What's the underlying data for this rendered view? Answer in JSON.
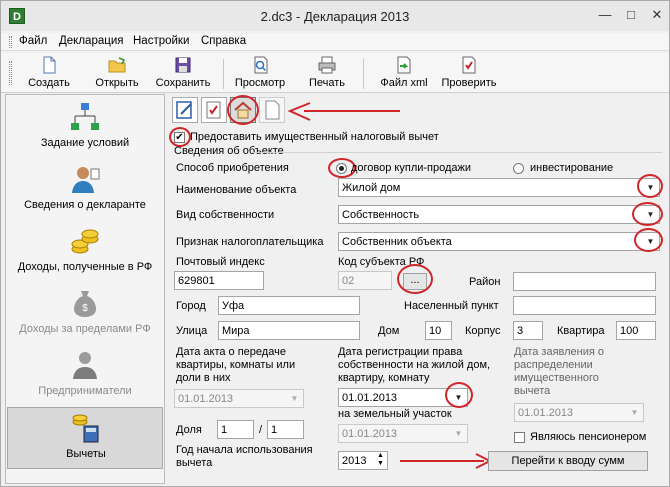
{
  "window": {
    "title": "2.dc3 - Декларация 2013",
    "app_icon": "D"
  },
  "menu": [
    "Файл",
    "Декларация",
    "Настройки",
    "Справка"
  ],
  "toolbar": {
    "create": "Создать",
    "open": "Открыть",
    "save": "Сохранить",
    "preview": "Просмотр",
    "print": "Печать",
    "xml": "Файл xml",
    "check": "Проверить"
  },
  "sidebar": [
    {
      "label": "Задание условий"
    },
    {
      "label": "Сведения о декларанте"
    },
    {
      "label": "Доходы, полученные в РФ"
    },
    {
      "label": "Доходы за пределами РФ"
    },
    {
      "label": "Предприниматели"
    },
    {
      "label": "Вычеты"
    }
  ],
  "form": {
    "provide_deduction": "Предоставить имущественный налоговый вычет",
    "section_title": "Сведения об объекте",
    "acquisition_method": "Способ приобретения",
    "opt_contract": "договор купли-продажи",
    "opt_investment": "инвестирование",
    "object_name_label": "Наименование объекта",
    "object_name_value": "Жилой дом",
    "ownership_label": "Вид собственности",
    "ownership_value": "Собственность",
    "taxpayer_label": "Признак налогоплательщика",
    "taxpayer_value": "Собственник объекта",
    "postcode_label": "Почтовый индекс",
    "postcode_value": "629801",
    "region_code_label": "Код субъекта РФ",
    "region_code_value": "02",
    "ellipsis": "...",
    "district_label": "Район",
    "city_label": "Город",
    "city_value": "Уфа",
    "locality_label": "Населенный пункт",
    "street_label": "Улица",
    "street_value": "Мира",
    "house_label": "Дом",
    "house_value": "10",
    "building_label": "Корпус",
    "building_value": "3",
    "flat_label": "Квартира",
    "flat_value": "100",
    "act_date_label": "Дата акта о передаче квартиры, комнаты или доли в них",
    "act_date_value": "01.01.2013",
    "reg_date_label": "Дата регистрации права собственности на жилой дом, квартиру, комнату",
    "reg_date_value": "01.01.2013",
    "land_label": "на земельный участок",
    "land_value": "01.01.2013",
    "app_date_label": "Дата заявления о распределении имущественного вычета",
    "app_date_value": "01.01.2013",
    "share_label": "Доля",
    "share_num": "1",
    "share_slash": "/",
    "share_den": "1",
    "pensioner_label": "Являюсь пенсионером",
    "start_year_label": "Год начала использования вычета",
    "start_year_value": "2013",
    "go_button": "Перейти к вводу сумм"
  }
}
